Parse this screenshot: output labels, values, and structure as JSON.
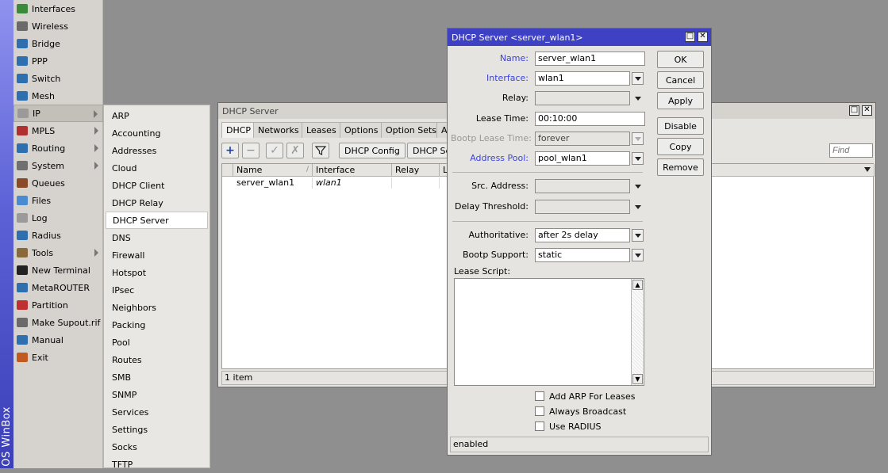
{
  "brand": {
    "text": "OS WinBox"
  },
  "main_menu": {
    "items": [
      {
        "label": "Interfaces",
        "icon": "interfaces-icon",
        "color": "#3a8a3a",
        "has_submenu": false
      },
      {
        "label": "Wireless",
        "icon": "wireless-icon",
        "color": "#6a6a6a",
        "has_submenu": false
      },
      {
        "label": "Bridge",
        "icon": "bridge-icon",
        "color": "#2f6fb0",
        "has_submenu": false
      },
      {
        "label": "PPP",
        "icon": "ppp-icon",
        "color": "#2f6fb0",
        "has_submenu": false
      },
      {
        "label": "Switch",
        "icon": "switch-icon",
        "color": "#2f6fb0",
        "has_submenu": false
      },
      {
        "label": "Mesh",
        "icon": "mesh-icon",
        "color": "#2f6fb0",
        "has_submenu": false
      },
      {
        "label": "IP",
        "icon": "ip-icon",
        "color": "#9a9a9a",
        "has_submenu": true
      },
      {
        "label": "MPLS",
        "icon": "mpls-icon",
        "color": "#b03030",
        "has_submenu": true
      },
      {
        "label": "Routing",
        "icon": "routing-icon",
        "color": "#2f6fb0",
        "has_submenu": true
      },
      {
        "label": "System",
        "icon": "system-icon",
        "color": "#707070",
        "has_submenu": true
      },
      {
        "label": "Queues",
        "icon": "queues-icon",
        "color": "#8a4a2a",
        "has_submenu": false
      },
      {
        "label": "Files",
        "icon": "files-icon",
        "color": "#4a8ad0",
        "has_submenu": false
      },
      {
        "label": "Log",
        "icon": "log-icon",
        "color": "#9a9a9a",
        "has_submenu": false
      },
      {
        "label": "Radius",
        "icon": "radius-icon",
        "color": "#2f6fb0",
        "has_submenu": false
      },
      {
        "label": "Tools",
        "icon": "tools-icon",
        "color": "#8a6a3a",
        "has_submenu": true
      },
      {
        "label": "New Terminal",
        "icon": "terminal-icon",
        "color": "#222222",
        "has_submenu": false
      },
      {
        "label": "MetaROUTER",
        "icon": "metarouter-icon",
        "color": "#2f6fb0",
        "has_submenu": false
      },
      {
        "label": "Partition",
        "icon": "partition-icon",
        "color": "#c03030",
        "has_submenu": false
      },
      {
        "label": "Make Supout.rif",
        "icon": "supout-icon",
        "color": "#6a6a6a",
        "has_submenu": false
      },
      {
        "label": "Manual",
        "icon": "manual-icon",
        "color": "#2f6fb0",
        "has_submenu": false
      },
      {
        "label": "Exit",
        "icon": "exit-icon",
        "color": "#c05a20",
        "has_submenu": false
      }
    ]
  },
  "ip_submenu": {
    "items": [
      "ARP",
      "Accounting",
      "Addresses",
      "Cloud",
      "DHCP Client",
      "DHCP Relay",
      "DHCP Server",
      "DNS",
      "Firewall",
      "Hotspot",
      "IPsec",
      "Neighbors",
      "Packing",
      "Pool",
      "Routes",
      "SMB",
      "SNMP",
      "Services",
      "Settings",
      "Socks",
      "TFTP"
    ],
    "active": "DHCP Server"
  },
  "dhcp_window": {
    "title": "DHCP Server",
    "tabs": [
      "DHCP",
      "Networks",
      "Leases",
      "Options",
      "Option Sets",
      "A"
    ],
    "buttons": {
      "config": "DHCP Config",
      "setup": "DHCP Se"
    },
    "find_placeholder": "Find",
    "columns": [
      "Name",
      "Interface",
      "Relay",
      "L"
    ],
    "rows": [
      {
        "name": "server_wlan1",
        "interface": "wlan1",
        "relay": ""
      }
    ],
    "count": "1 item"
  },
  "edit_dialog": {
    "title": "DHCP Server <server_wlan1>",
    "fields": {
      "name": {
        "label": "Name:",
        "value": "server_wlan1"
      },
      "interface": {
        "label": "Interface:",
        "value": "wlan1"
      },
      "relay": {
        "label": "Relay:",
        "value": ""
      },
      "lease_time": {
        "label": "Lease Time:",
        "value": "00:10:00"
      },
      "bootp_lease_time": {
        "label": "Bootp Lease Time:",
        "value": "forever"
      },
      "address_pool": {
        "label": "Address Pool:",
        "value": "pool_wlan1"
      },
      "src_address": {
        "label": "Src. Address:",
        "value": ""
      },
      "delay_threshold": {
        "label": "Delay Threshold:",
        "value": ""
      },
      "authoritative": {
        "label": "Authoritative:",
        "value": "after 2s delay"
      },
      "bootp_support": {
        "label": "Bootp Support:",
        "value": "static"
      },
      "lease_script": {
        "label": "Lease Script:",
        "value": ""
      }
    },
    "checkboxes": [
      {
        "label": "Add ARP For Leases",
        "checked": false
      },
      {
        "label": "Always Broadcast",
        "checked": false
      },
      {
        "label": "Use RADIUS",
        "checked": false
      }
    ],
    "buttons": {
      "ok": "OK",
      "cancel": "Cancel",
      "apply": "Apply",
      "disable": "Disable",
      "copy": "Copy",
      "remove": "Remove"
    },
    "status": "enabled"
  }
}
